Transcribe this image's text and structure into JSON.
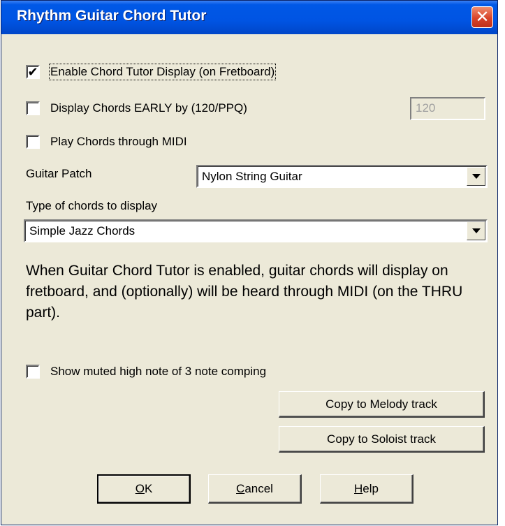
{
  "window": {
    "title": "Rhythm Guitar Chord Tutor",
    "close_glyph": "✕"
  },
  "options": {
    "enable_tutor": {
      "label": "Enable Chord Tutor Display (on Fretboard)",
      "checked": true,
      "mark": "✔"
    },
    "display_early": {
      "label": "Display Chords EARLY by (120/PPQ)",
      "checked": false,
      "value": "120"
    },
    "play_midi": {
      "label": "Play Chords through MIDI",
      "checked": false
    }
  },
  "guitar_patch": {
    "label": "Guitar Patch",
    "selected": "Nylon String Guitar"
  },
  "chord_type": {
    "label": "Type of chords to display",
    "selected": "Simple Jazz Chords"
  },
  "description": "When Guitar Chord Tutor is enabled, guitar chords will display on fretboard, and (optionally) will be heard through MIDI (on the THRU part).",
  "show_muted": {
    "label": "Show muted high note of 3 note comping",
    "checked": false
  },
  "actions": {
    "copy_melody": "Copy to Melody track",
    "copy_soloist": "Copy to Soloist track"
  },
  "footer": {
    "ok_mnemonic": "O",
    "ok_rest": "K",
    "cancel_mnemonic": "C",
    "cancel_rest": "ancel",
    "help_mnemonic": "H",
    "help_rest": "elp"
  },
  "colors": {
    "titlebar": "#0054e3",
    "dialog_bg": "#ece9d8",
    "close_button": "#d8442a"
  }
}
